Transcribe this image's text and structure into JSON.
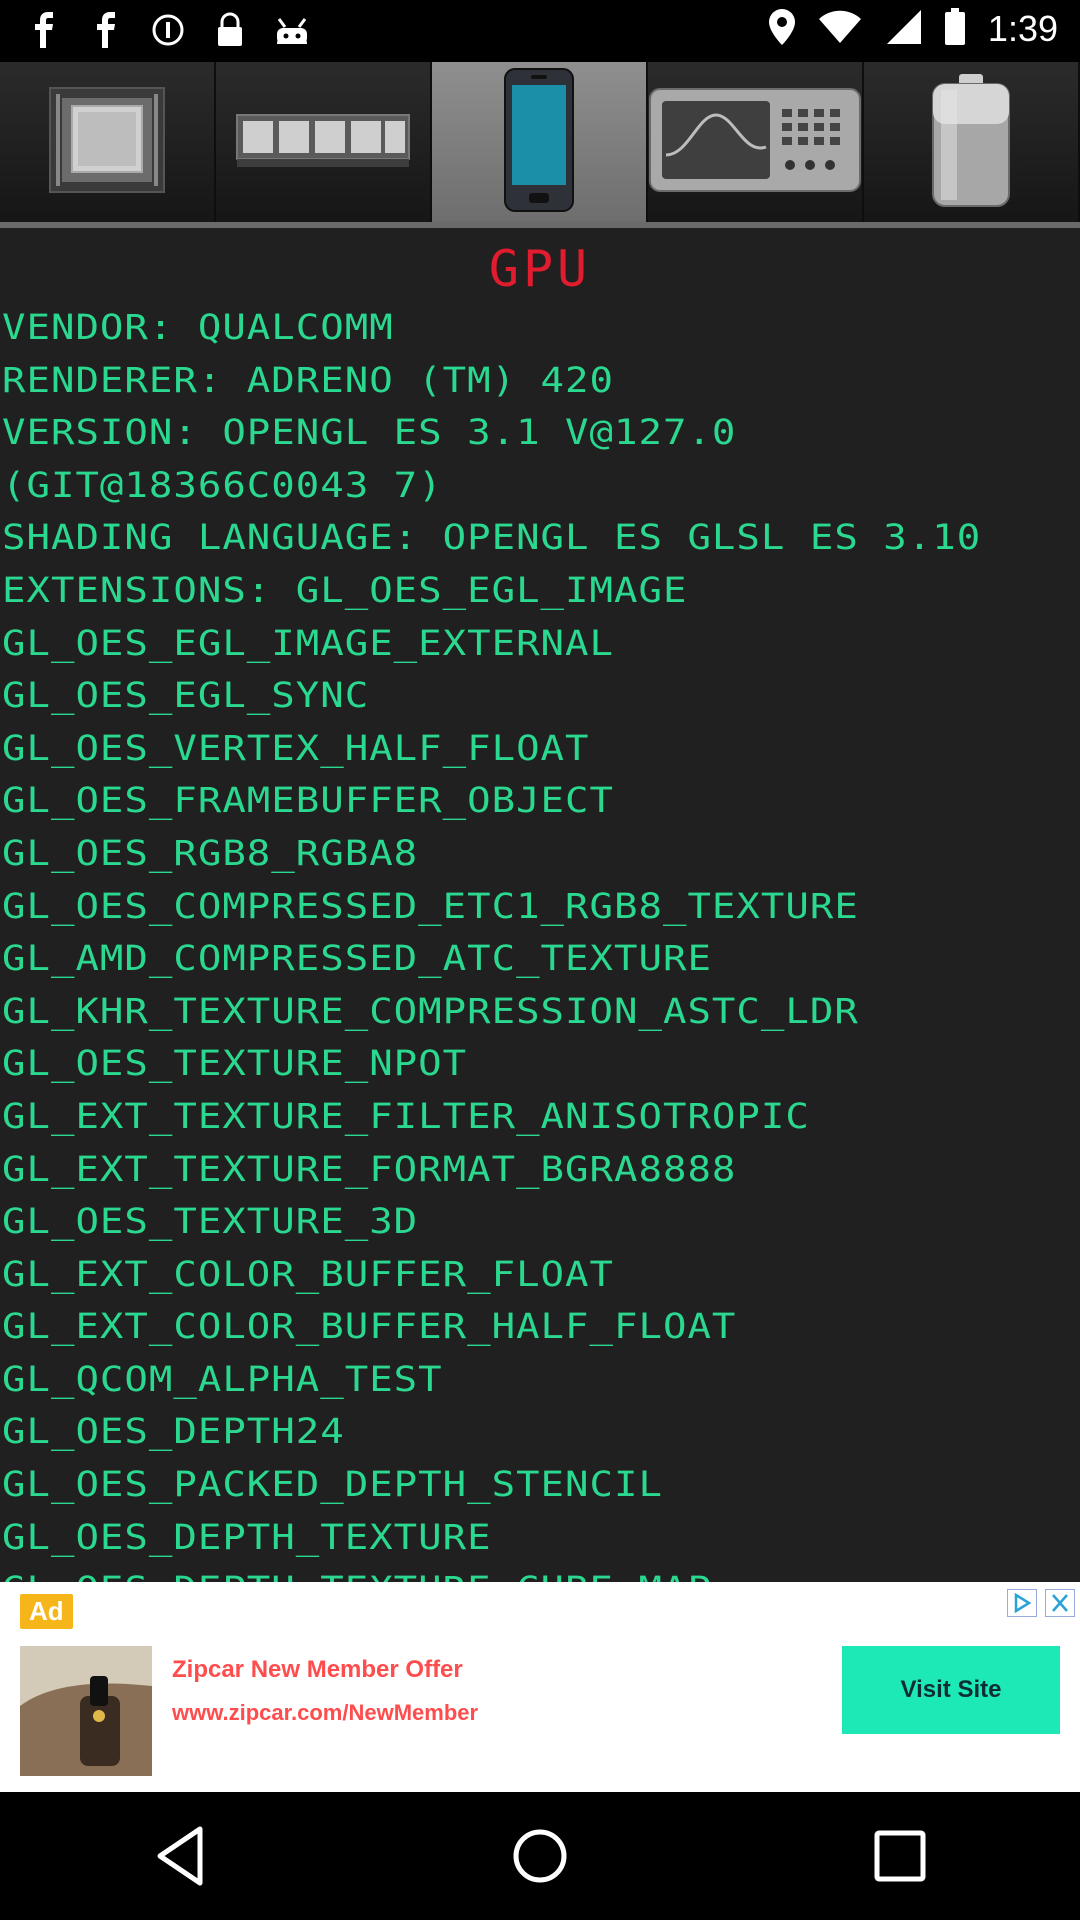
{
  "status_bar": {
    "time": "1:39",
    "left_icons": [
      "facebook-icon",
      "facebook-icon",
      "info-icon",
      "lock-icon",
      "android-icon"
    ],
    "right_icons": [
      "location-icon",
      "wifi-icon",
      "signal-icon",
      "battery-icon"
    ]
  },
  "tabs": [
    {
      "name": "cpu-tab",
      "icon": "cpu-chip-icon",
      "active": false
    },
    {
      "name": "memory-tab",
      "icon": "ram-stick-icon",
      "active": false
    },
    {
      "name": "device-tab",
      "icon": "smartphone-icon",
      "active": true
    },
    {
      "name": "gpu-tab",
      "icon": "oscilloscope-icon",
      "active": false
    },
    {
      "name": "battery-tab",
      "icon": "battery-icon",
      "active": false
    }
  ],
  "section": {
    "title": "GPU",
    "title_color": "#e21c2f",
    "text_color": "#2bd88f",
    "lines": [
      "VENDOR: QUALCOMM",
      "RENDERER: ADRENO (TM) 420",
      "VERSION: OPENGL ES 3.1 V@127.0",
      "(GIT@18366C0043 7)",
      "SHADING LANGUAGE: OPENGL ES GLSL ES 3.10",
      "EXTENSIONS: GL_OES_EGL_IMAGE",
      "GL_OES_EGL_IMAGE_EXTERNAL",
      "GL_OES_EGL_SYNC",
      "GL_OES_VERTEX_HALF_FLOAT",
      "GL_OES_FRAMEBUFFER_OBJECT",
      "GL_OES_RGB8_RGBA8",
      "GL_OES_COMPRESSED_ETC1_RGB8_TEXTURE",
      "GL_AMD_COMPRESSED_ATC_TEXTURE",
      "GL_KHR_TEXTURE_COMPRESSION_ASTC_LDR",
      "GL_OES_TEXTURE_NPOT",
      "GL_EXT_TEXTURE_FILTER_ANISOTROPIC",
      "GL_EXT_TEXTURE_FORMAT_BGRA8888",
      "GL_OES_TEXTURE_3D",
      "GL_EXT_COLOR_BUFFER_FLOAT",
      "GL_EXT_COLOR_BUFFER_HALF_FLOAT",
      "GL_QCOM_ALPHA_TEST",
      "GL_OES_DEPTH24",
      "GL_OES_PACKED_DEPTH_STENCIL",
      "GL_OES_DEPTH_TEXTURE",
      "GL_OES_DEPTH_TEXTURE_CUBE_MAP"
    ]
  },
  "ad": {
    "badge": "Ad",
    "title": "Zipcar New Member Offer",
    "url": "www.zipcar.com/NewMember",
    "cta": "Visit Site",
    "cta_color": "#1de9b6",
    "text_color": "#ff4c4c"
  },
  "nav": {
    "buttons": [
      "back-icon",
      "home-icon",
      "recents-icon"
    ]
  }
}
